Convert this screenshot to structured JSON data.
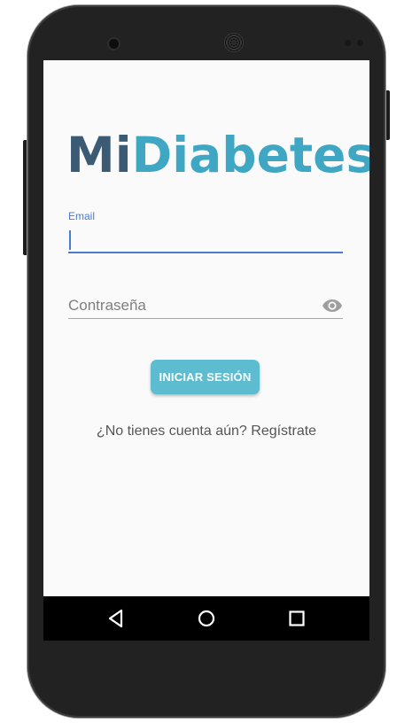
{
  "logo": {
    "part1": "Mi",
    "part2": "Diabetes"
  },
  "login": {
    "email_label": "Email",
    "email_value": "",
    "password_placeholder": "Contraseña",
    "password_value": "",
    "submit_label": "INICIAR SESIÓN",
    "register_text": "¿No tienes cuenta aún? Regístrate"
  },
  "icons": {
    "password_toggle": "eye-icon",
    "nav_back": "back-triangle-icon",
    "nav_home": "home-circle-icon",
    "nav_recents": "recents-square-icon"
  },
  "colors": {
    "logo_mi": "#3b5a74",
    "logo_diabetes": "#3fa7c3",
    "accent": "#4a7bd5",
    "button": "#5dbccf",
    "screen_bg": "#fafafa"
  }
}
